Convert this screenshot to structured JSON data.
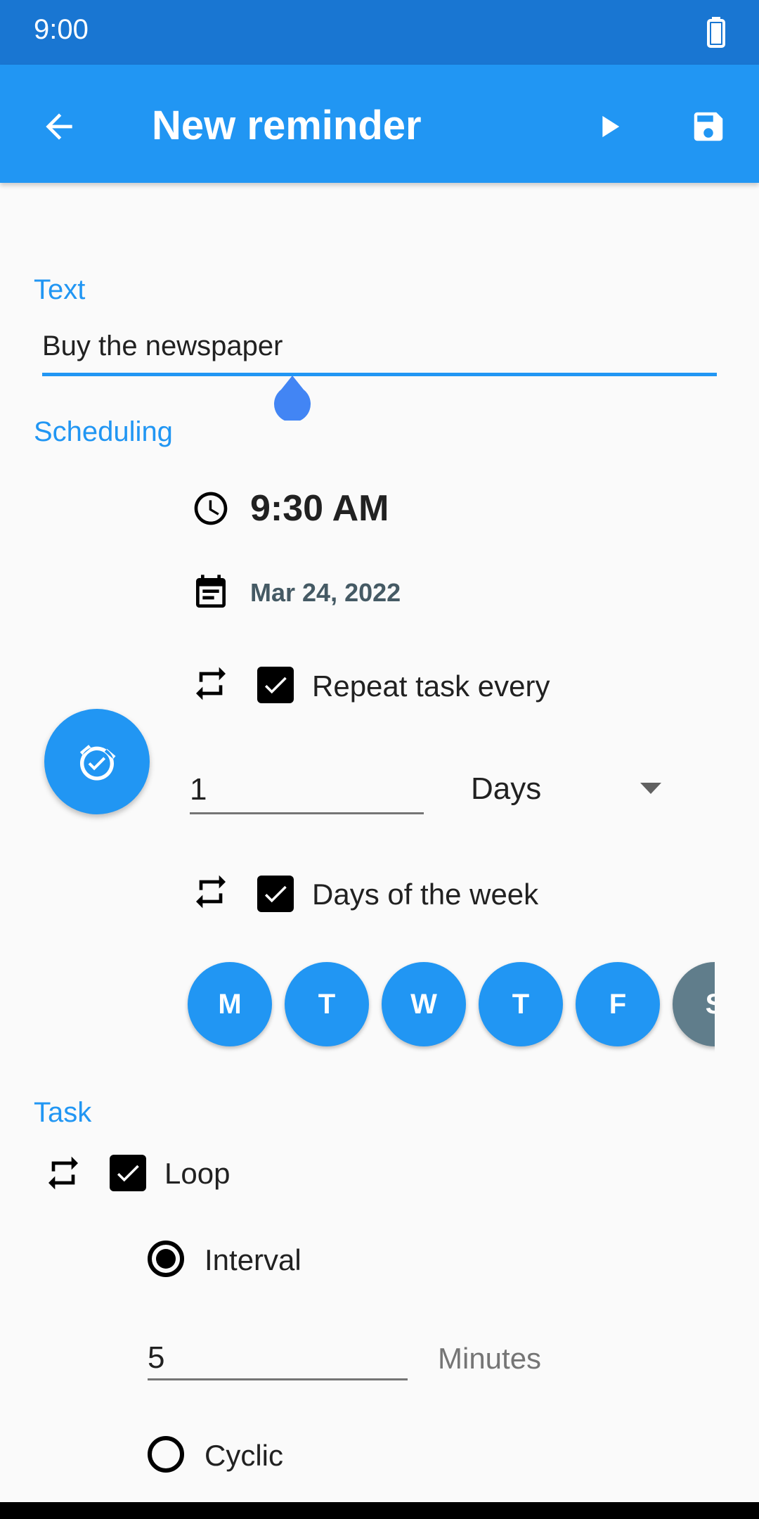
{
  "status": {
    "time": "9:00"
  },
  "appbar": {
    "title": "New reminder",
    "back_icon": "arrow-back-icon",
    "play_icon": "play-icon",
    "save_icon": "save-icon"
  },
  "text_section": {
    "label": "Text",
    "value": "Buy the newspaper"
  },
  "scheduling": {
    "label": "Scheduling",
    "time": "9:30 AM",
    "date": "Mar 24, 2022",
    "repeat_label": "Repeat task every",
    "repeat_checked": true,
    "repeat_value": "1",
    "repeat_unit": "Days",
    "days_of_week_label": "Days of the week",
    "days_of_week_checked": true,
    "days": [
      "M",
      "T",
      "W",
      "T",
      "F",
      "S"
    ]
  },
  "task": {
    "label": "Task",
    "loop_label": "Loop",
    "loop_checked": true,
    "interval_label": "Interval",
    "interval_value": "5",
    "interval_unit": "Minutes",
    "cyclic_label": "Cyclic",
    "selected_mode": "Interval"
  },
  "colors": {
    "primary": "#2196f3",
    "primary_dark": "#1976d2",
    "accent_gray": "#607d8b"
  }
}
